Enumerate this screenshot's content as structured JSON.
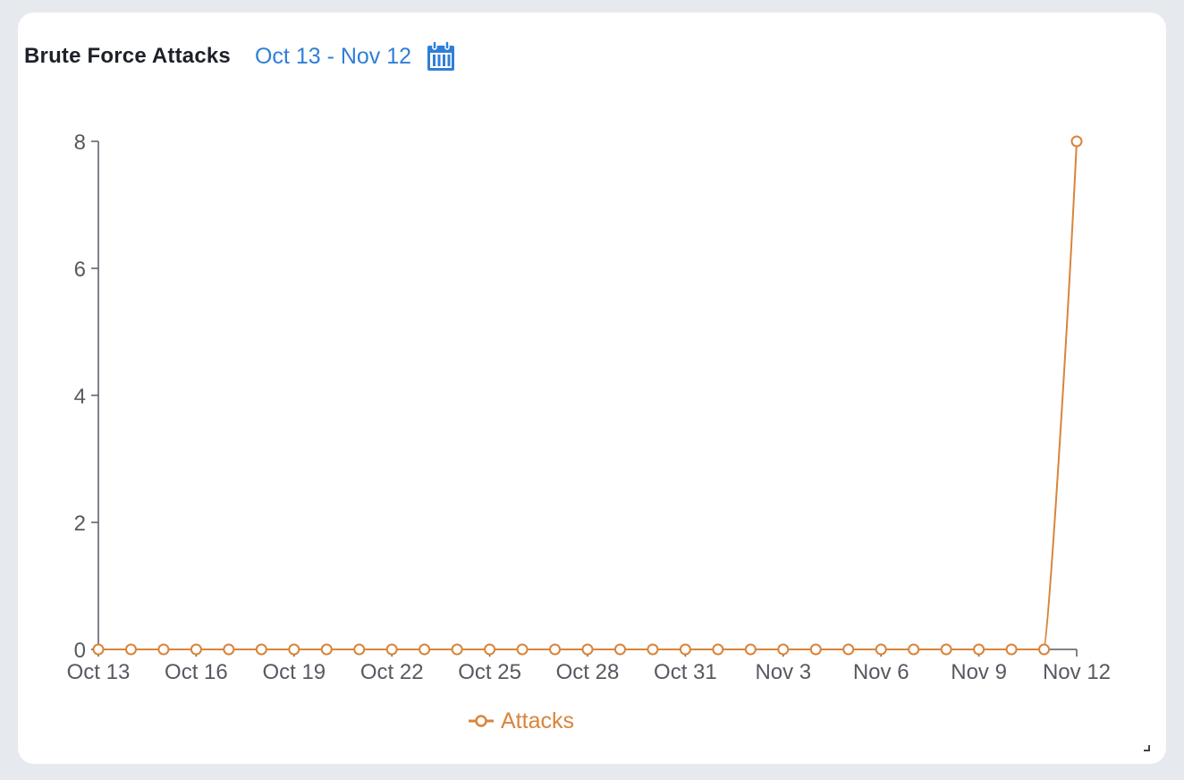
{
  "card": {
    "title": "Brute Force Attacks",
    "date_range": "Oct 13 - Nov 12",
    "calendar_icon": "calendar-icon"
  },
  "colors": {
    "series": "#d9843a",
    "link": "#2f7fd6",
    "axis": "#555a61"
  },
  "chart_data": {
    "type": "line",
    "title": "",
    "xlabel": "",
    "ylabel": "",
    "x": [
      "Oct 13",
      "Oct 14",
      "Oct 15",
      "Oct 16",
      "Oct 17",
      "Oct 18",
      "Oct 19",
      "Oct 20",
      "Oct 21",
      "Oct 22",
      "Oct 23",
      "Oct 24",
      "Oct 25",
      "Oct 26",
      "Oct 27",
      "Oct 28",
      "Oct 29",
      "Oct 30",
      "Oct 31",
      "Nov 1",
      "Nov 2",
      "Nov 3",
      "Nov 4",
      "Nov 5",
      "Nov 6",
      "Nov 7",
      "Nov 8",
      "Nov 9",
      "Nov 10",
      "Nov 11",
      "Nov 12"
    ],
    "x_tick_labels": [
      "Oct 13",
      "Oct 16",
      "Oct 19",
      "Oct 22",
      "Oct 25",
      "Oct 28",
      "Oct 31",
      "Nov 3",
      "Nov 6",
      "Nov 9",
      "Nov 12"
    ],
    "y_ticks": [
      0,
      2,
      4,
      6,
      8
    ],
    "ylim": [
      0,
      8
    ],
    "series": [
      {
        "name": "Attacks",
        "values": [
          0,
          0,
          0,
          0,
          0,
          0,
          0,
          0,
          0,
          0,
          0,
          0,
          0,
          0,
          0,
          0,
          0,
          0,
          0,
          0,
          0,
          0,
          0,
          0,
          0,
          0,
          0,
          0,
          0,
          0,
          8
        ]
      }
    ],
    "legend": "bottom-center",
    "grid": false
  }
}
